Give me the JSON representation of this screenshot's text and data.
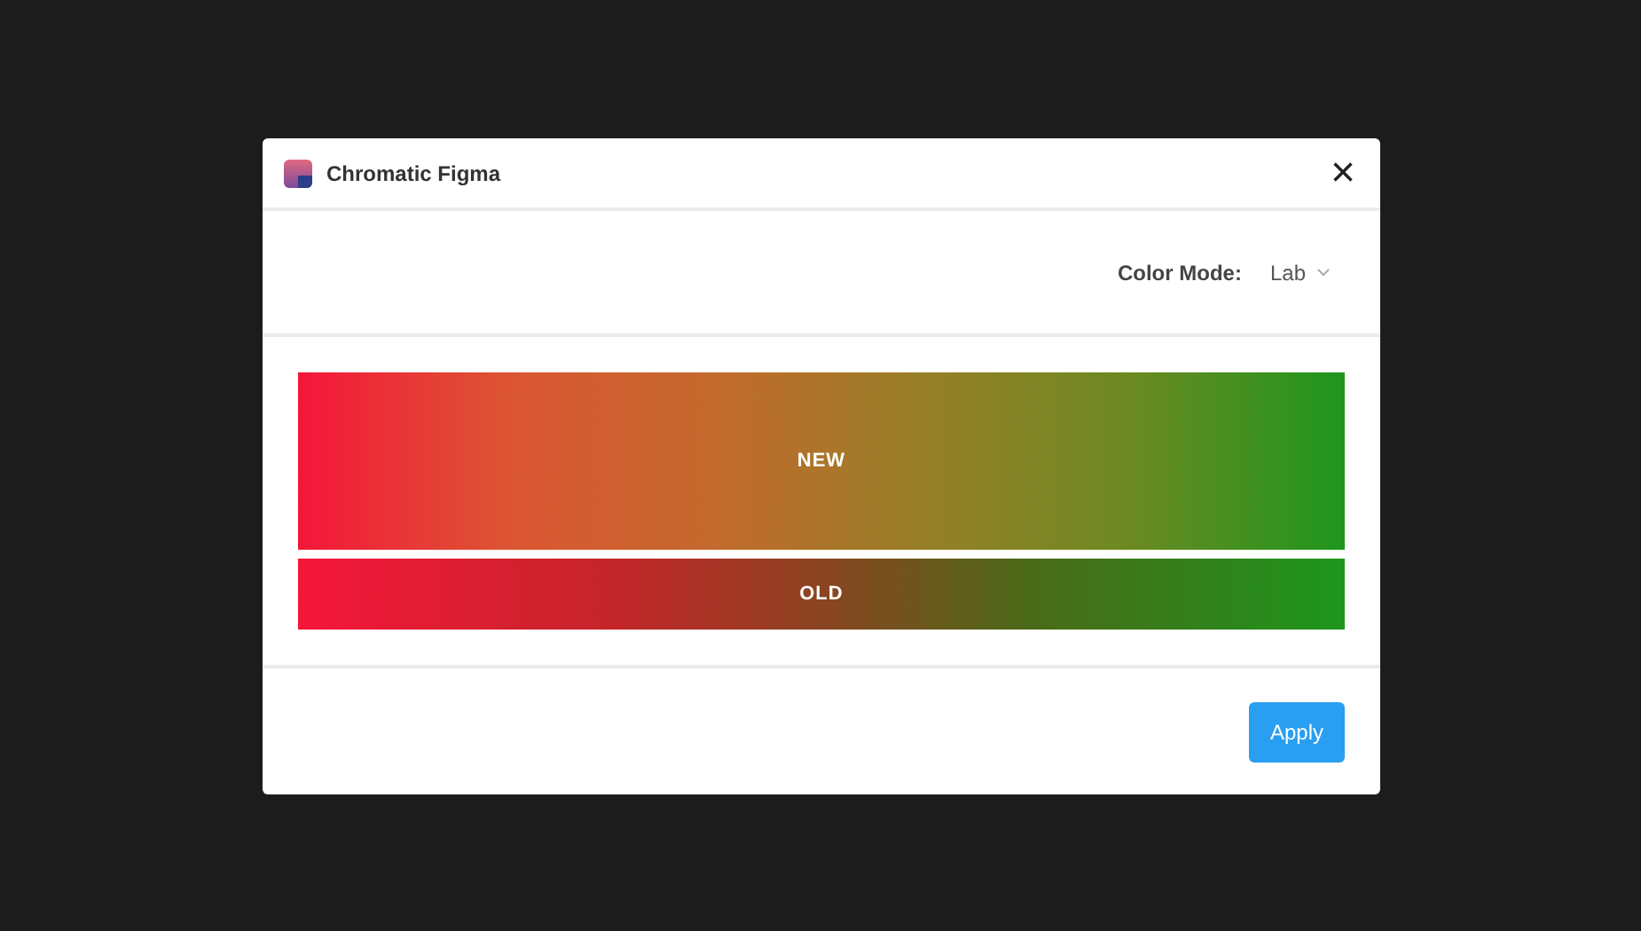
{
  "window": {
    "title": "Chromatic Figma",
    "close": "×"
  },
  "color_mode": {
    "label": "Color Mode:",
    "value": "Lab"
  },
  "bars": [
    {
      "label": "NEW",
      "kind": "new"
    },
    {
      "label": "OLD",
      "kind": "old"
    }
  ],
  "buttons": [
    "Apply"
  ]
}
